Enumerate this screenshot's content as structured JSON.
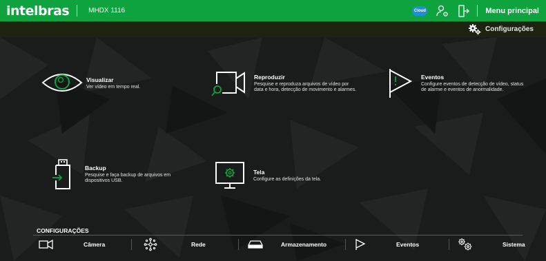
{
  "header": {
    "logo": "intelbras",
    "model": "MHDX 1116",
    "cloud_badge": "Cloud",
    "main_menu_label": "Menu principal",
    "icons": [
      "cloud-icon",
      "user-settings-icon",
      "logout-icon"
    ]
  },
  "subbar": {
    "settings_label": "Configurações",
    "icon": "gears-icon"
  },
  "tiles": [
    {
      "title": "Visualizar",
      "desc": "Ver vídeo em tempo real.",
      "icon": "eye-icon"
    },
    {
      "title": "Reproduzir",
      "desc_lines": [
        "Pesquise e reproduza arquivos de vídeo por",
        "data e hora, detecção de movimento e alarmes."
      ],
      "icon": "video-search-icon"
    },
    {
      "title": "Eventos",
      "desc_lines": [
        "Configure eventos de detecção de vídeo, status",
        "de alarme e eventos de anormalidade."
      ],
      "icon": "flag-icon"
    },
    {
      "title": "Backup",
      "desc_lines": [
        "Pesquise e faça backup de arquivos em",
        "dispositivos USB."
      ],
      "icon": "usb-backup-icon"
    },
    {
      "title": "Tela",
      "desc": "Configure as definições da tela.",
      "icon": "monitor-settings-icon"
    }
  ],
  "bottom": {
    "title": "CONFIGURAÇÕES",
    "items": [
      {
        "label": "Câmera",
        "icon": "camera-icon"
      },
      {
        "label": "Rede",
        "icon": "network-icon"
      },
      {
        "label": "Armazenamento",
        "icon": "storage-icon"
      },
      {
        "label": "Eventos",
        "icon": "flag-icon"
      },
      {
        "label": "Sistema",
        "icon": "system-gears-icon"
      }
    ]
  },
  "colors": {
    "accent": "#0ea33f",
    "cloud": "#1c8fd8",
    "background": "#1a1b1b"
  }
}
